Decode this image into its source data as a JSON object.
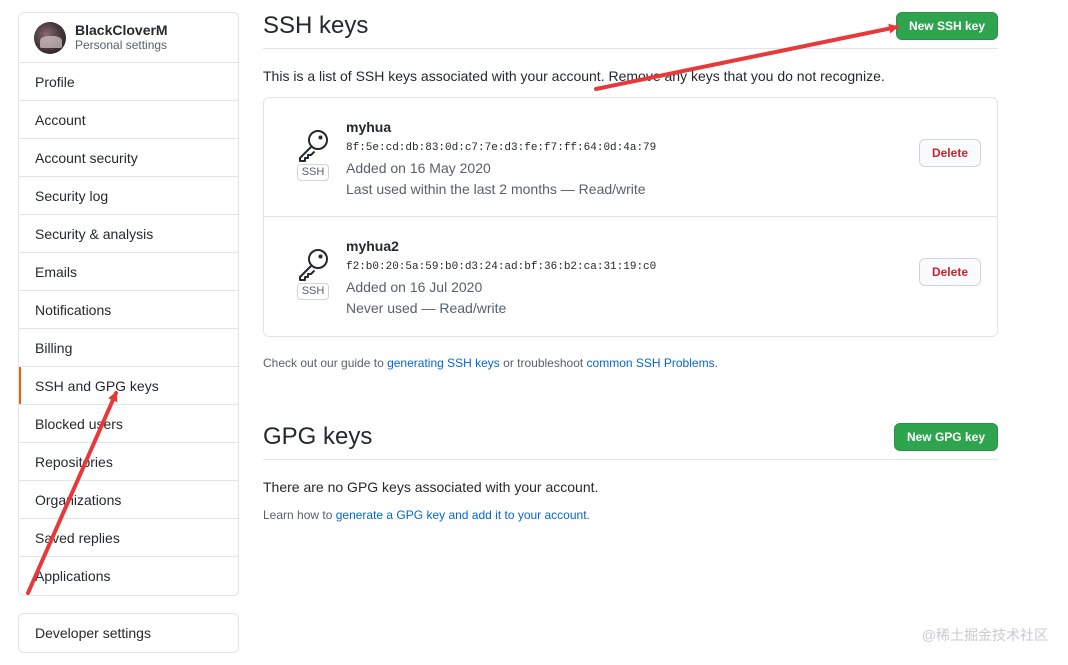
{
  "sidebar": {
    "user": {
      "name": "BlackCloverM",
      "subtitle": "Personal settings"
    },
    "items": [
      {
        "label": "Profile"
      },
      {
        "label": "Account"
      },
      {
        "label": "Account security"
      },
      {
        "label": "Security log"
      },
      {
        "label": "Security & analysis"
      },
      {
        "label": "Emails"
      },
      {
        "label": "Notifications"
      },
      {
        "label": "Billing"
      },
      {
        "label": "SSH and GPG keys",
        "selected": true
      },
      {
        "label": "Blocked users"
      },
      {
        "label": "Repositories"
      },
      {
        "label": "Organizations"
      },
      {
        "label": "Saved replies"
      },
      {
        "label": "Applications"
      }
    ],
    "developer_settings": "Developer settings"
  },
  "ssh": {
    "title": "SSH keys",
    "new_button": "New SSH key",
    "intro": "This is a list of SSH keys associated with your account. Remove any keys that you do not recognize.",
    "keys": [
      {
        "title": "myhua",
        "fingerprint": "8f:5e:cd:db:83:0d:c7:7e:d3:fe:f7:ff:64:0d:4a:79",
        "added": "Added on 16 May 2020",
        "last_used": "Last used within the last 2 months — Read/write",
        "badge": "SSH",
        "delete_label": "Delete"
      },
      {
        "title": "myhua2",
        "fingerprint": "f2:b0:20:5a:59:b0:d3:24:ad:bf:36:b2:ca:31:19:c0",
        "added": "Added on 16 Jul 2020",
        "last_used": "Never used — Read/write",
        "badge": "SSH",
        "delete_label": "Delete"
      }
    ],
    "help": {
      "prefix": "Check out our guide to ",
      "link1": "generating SSH keys",
      "middle": " or troubleshoot ",
      "link2": "common SSH Problems",
      "suffix": "."
    }
  },
  "gpg": {
    "title": "GPG keys",
    "new_button": "New GPG key",
    "empty": "There are no GPG keys associated with your account.",
    "learn": {
      "prefix": "Learn how to ",
      "link": "generate a GPG key and add it to your account",
      "suffix": "."
    }
  },
  "watermark": "@稀土掘金技术社区",
  "colors": {
    "primary_button": "#2ea44f",
    "danger_text": "#cb2431",
    "link": "#0366d6",
    "selected_accent": "#e36209",
    "annotation_arrow": "#e8393a"
  }
}
